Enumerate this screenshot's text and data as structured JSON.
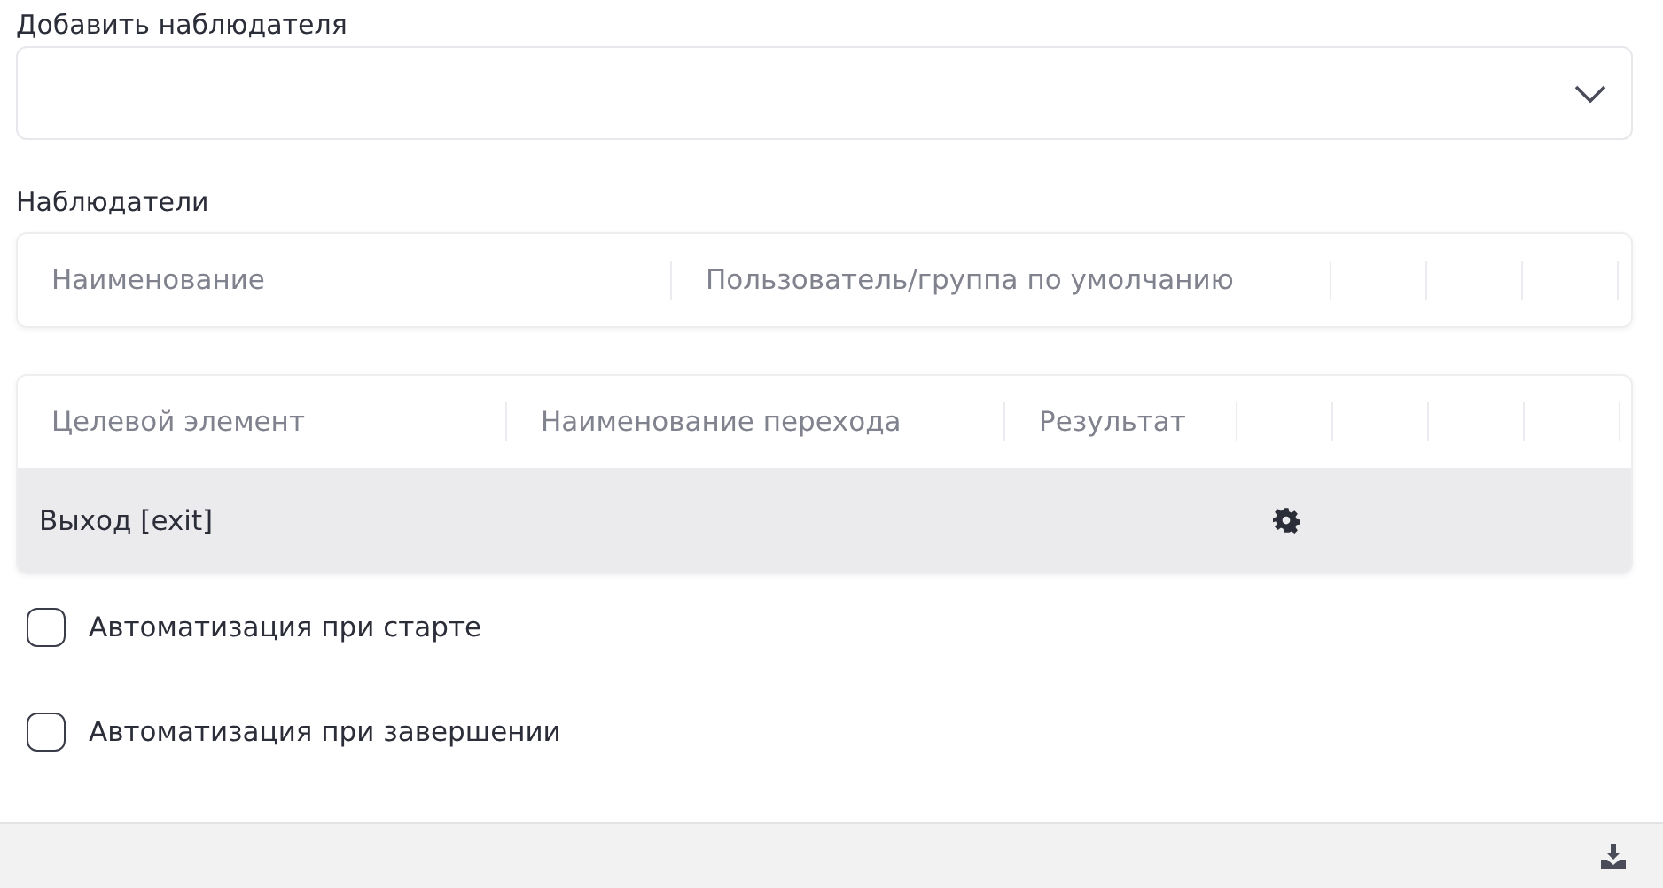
{
  "add_observer": {
    "label": "Добавить наблюдателя"
  },
  "observers": {
    "title": "Наблюдатели",
    "columns": [
      "Наименование",
      "Пользователь/группа по умолчанию"
    ]
  },
  "transitions": {
    "columns": [
      "Целевой элемент",
      "Наименование перехода",
      "Результат"
    ],
    "rows": [
      {
        "target": "Выход [exit]",
        "selected": true
      }
    ]
  },
  "options": [
    {
      "label": "Автоматизация при старте",
      "checked": false
    },
    {
      "label": "Автоматизация при завершении",
      "checked": false
    }
  ]
}
